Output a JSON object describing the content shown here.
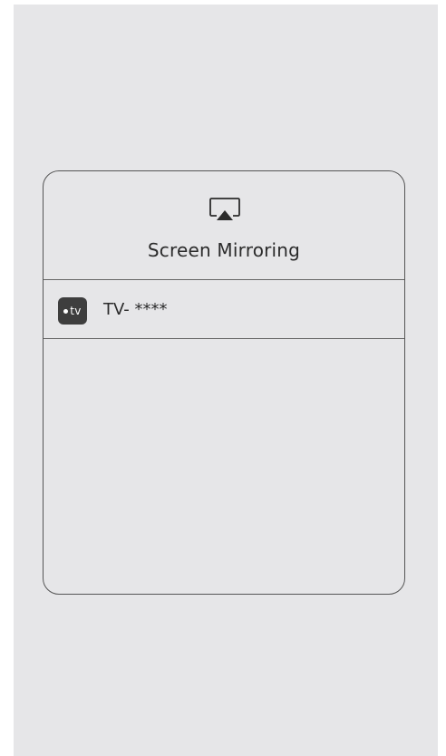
{
  "dialog": {
    "title": "Screen Mirroring",
    "icon": "airplay-icon"
  },
  "devices": [
    {
      "badge_text": "tv",
      "badge_icon": "apple-tv-icon",
      "name": "TV- ****"
    }
  ],
  "colors": {
    "background": "#e6e6e8",
    "border": "#555555",
    "text": "#2b2b2b",
    "badge": "#3e3e3e"
  }
}
